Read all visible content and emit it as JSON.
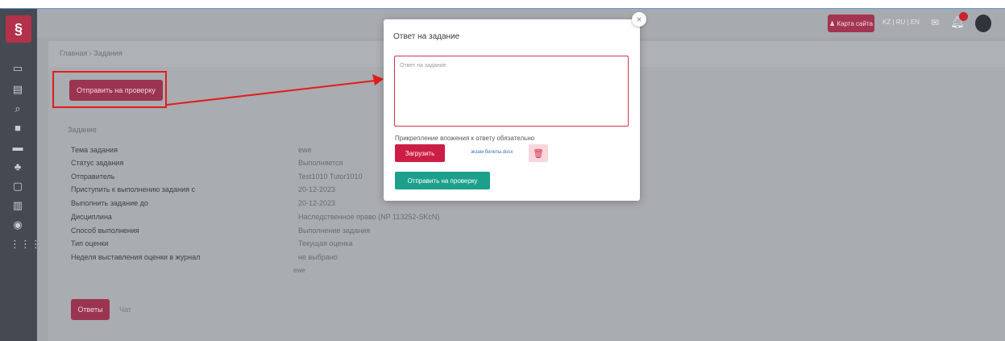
{
  "sidebar": {
    "logo": "§",
    "icons": [
      "monitor-icon",
      "certificate-icon",
      "search-doc-icon",
      "book-icon",
      "folder-icon",
      "users-icon",
      "clipboard-icon",
      "id-card-icon",
      "webcam-icon",
      "grid-icon"
    ]
  },
  "header": {
    "site_map": "Карта сайта",
    "languages": "KZ | RU | EN"
  },
  "breadcrumb": "Главная  ›  Задания",
  "main": {
    "send_review_button": "Отправить на проверку",
    "section_title": "Задание",
    "fields": [
      {
        "label": "Тема задания",
        "value": "ewe"
      },
      {
        "label": "Статус задания",
        "value": "Выполняется"
      },
      {
        "label": "Отправитель",
        "value": "Test1010 Tutor1010"
      },
      {
        "label": "Приступить к выполнению задания с",
        "value": "20-12-2023"
      },
      {
        "label": "Выполнить задание до",
        "value": "20-12-2023"
      },
      {
        "label": "Дисциплина",
        "value": "Наследственное право (NP 113252-SKcN)"
      },
      {
        "label": "Способ выполнения",
        "value": "Выполнение задания"
      },
      {
        "label": "Тип оценки",
        "value": "Текущая оценка"
      },
      {
        "label": "Неделя выставления оценки в журнал",
        "value": "не выбрано"
      }
    ],
    "extra_value": "ewe",
    "answers_button": "Ответы",
    "chat_tab": "Чат"
  },
  "modal": {
    "title": "Ответ на задание",
    "close": "×",
    "answer_placeholder": "Ответ на задание",
    "attach_note": "Прикрепление вложения к ответу обязательно",
    "upload_button": "Загрузить",
    "file_name": "экзам билеты.docx",
    "submit_button": "Отправить на проверку"
  },
  "colors": {
    "accent": "#cc1e45",
    "success": "#1ca08c",
    "sidebar": "#454a52",
    "overlay": "#a3a6ab",
    "highlight": "#e21d1d"
  }
}
